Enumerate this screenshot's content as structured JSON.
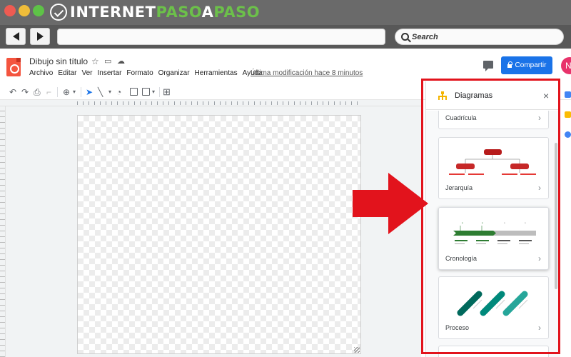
{
  "brand": {
    "part1": "INTERNET",
    "part2": "PASO",
    "part3": "A",
    "part4": "PASO"
  },
  "browser": {
    "search_placeholder": "Search"
  },
  "app": {
    "doc_title": "Dibujo sin título",
    "menu": [
      "Archivo",
      "Editar",
      "Ver",
      "Insertar",
      "Formato",
      "Organizar",
      "Herramientas",
      "Ayuda"
    ],
    "last_edit": "Última modificación hace 8 minutos",
    "share_label": "Compartir",
    "avatar_initial": "N",
    "share_color": "#1a73e8"
  },
  "panel": {
    "title": "Diagramas",
    "close": "×",
    "cards": [
      {
        "label": "Cuadrícula"
      },
      {
        "label": "Jerarquía"
      },
      {
        "label": "Cronología"
      },
      {
        "label": "Proceso"
      }
    ]
  },
  "annotation": {
    "highlight_color": "#e2131c"
  }
}
